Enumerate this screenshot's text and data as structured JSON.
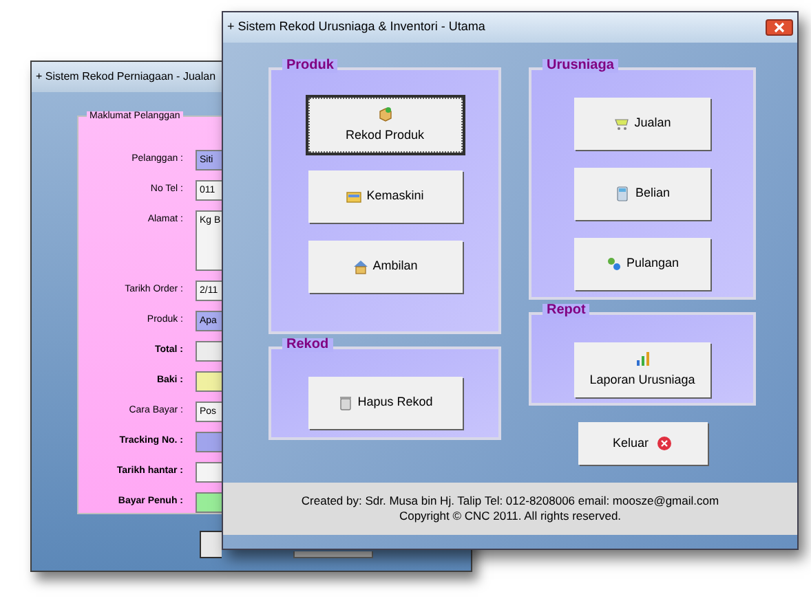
{
  "back_window": {
    "title": "+ Sistem Rekod Perniagaan - Jualan",
    "group_title": "Maklumat Pelanggan",
    "fields": [
      {
        "label": "Pelanggan :",
        "value": "Siti",
        "color": "#a8acf0",
        "bold": false,
        "kind": "line"
      },
      {
        "label": "No Tel :",
        "value": "011",
        "color": "#f4f4f4",
        "bold": false,
        "kind": "line"
      },
      {
        "label": "Alamat :",
        "value": "Kg B",
        "color": "#f4f4f4",
        "bold": false,
        "kind": "area"
      },
      {
        "label": "Tarikh Order :",
        "value": "2/11",
        "color": "#f4f4f4",
        "bold": false,
        "kind": "line"
      },
      {
        "label": "Produk :",
        "value": "Apa",
        "color": "#a8acf0",
        "bold": false,
        "kind": "line"
      },
      {
        "label": "Total :",
        "color": "#ececec",
        "bold": true,
        "kind": "line"
      },
      {
        "label": "Baki :",
        "color": "#f0f0a0",
        "bold": true,
        "kind": "line"
      },
      {
        "label": "Cara Bayar :",
        "value": "Pos",
        "color": "#f4f4f4",
        "bold": false,
        "kind": "line"
      },
      {
        "label": "Tracking No. :",
        "color": "#a0a4ec",
        "bold": true,
        "kind": "line"
      },
      {
        "label": "Tarikh hantar :",
        "color": "#f4f4f4",
        "bold": true,
        "kind": "line"
      },
      {
        "label": "Bayar Penuh :",
        "color": "#98ec98",
        "bold": true,
        "kind": "line"
      }
    ]
  },
  "main_window": {
    "title": "+ Sistem Rekod Urusniaga & Inventori - Utama",
    "left_groups": [
      {
        "title": "Produk",
        "buttons": [
          {
            "label": "Rekod Produk",
            "selected": true
          },
          {
            "label": "Kemaskini",
            "selected": false
          },
          {
            "label": "Ambilan",
            "selected": false
          }
        ]
      },
      {
        "title": "Rekod",
        "buttons": [
          {
            "label": "Hapus Rekod",
            "selected": false
          }
        ]
      }
    ],
    "right_groups": [
      {
        "title": "Urusniaga",
        "buttons": [
          {
            "label": "Jualan",
            "selected": false
          },
          {
            "label": "Belian",
            "selected": false
          },
          {
            "label": "Pulangan",
            "selected": false
          }
        ]
      },
      {
        "title": "Repot",
        "buttons": [
          {
            "label": "Laporan Urusniaga",
            "selected": false
          }
        ]
      }
    ],
    "exit_button": "Keluar",
    "footer": [
      "Created by:  Sdr. Musa bin Hj. Talip  Tel: 012-8208006  email: moosze@gmail.com",
      "Copyright  © CNC 2011.  All rights reserved."
    ]
  }
}
